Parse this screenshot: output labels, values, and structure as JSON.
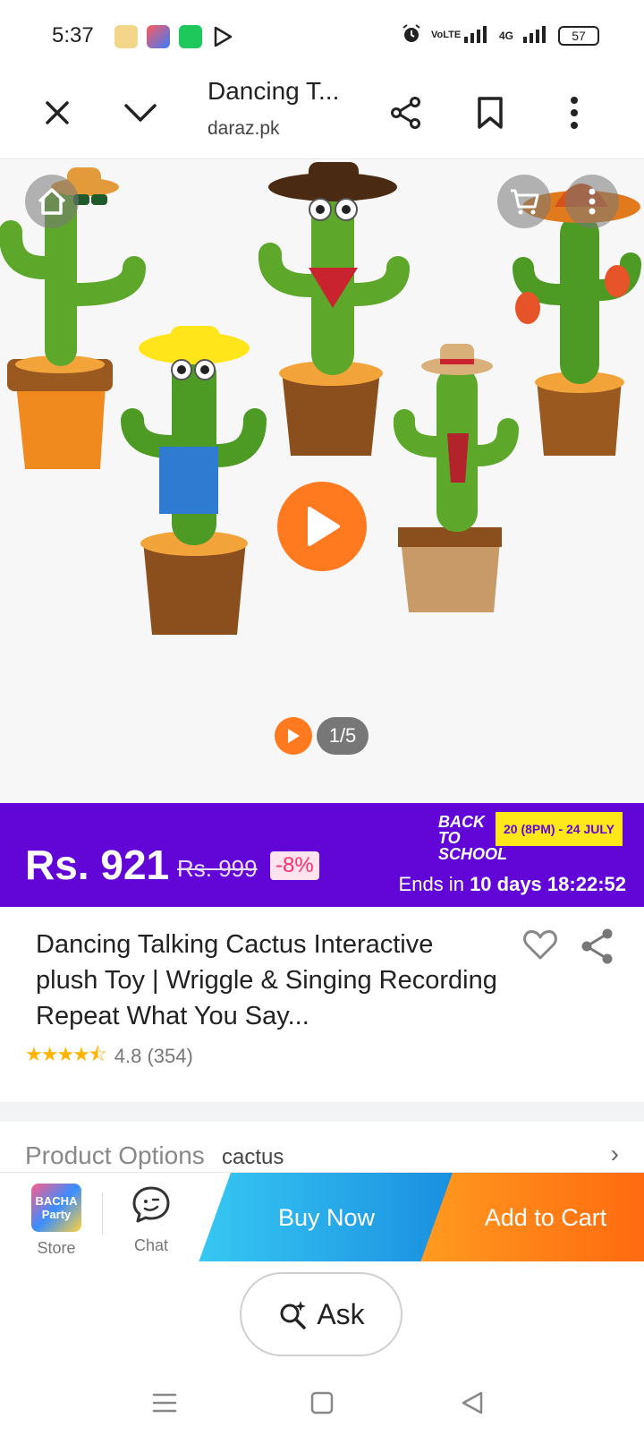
{
  "status_bar": {
    "time": "5:37",
    "volte": "VoLTE",
    "network": "4G",
    "battery": "57"
  },
  "browser": {
    "title": "Dancing T...",
    "domain": "daraz.pk"
  },
  "gallery": {
    "counter": "1/5"
  },
  "price": {
    "current": "Rs. 921",
    "original": "Rs. 999",
    "discount": "-8%",
    "promo_label": "BACK TO SCHOOL",
    "promo_dates": "20 (8PM) - 24 JULY",
    "ends_prefix": "Ends in",
    "ends_days": "10 days",
    "ends_time": "18:22:52"
  },
  "product": {
    "title": "Dancing Talking Cactus Interactive plush Toy | Wriggle & Singing Recording Repeat What You Say...",
    "rating": "4.8",
    "reviews": "(354)",
    "stars_value": 4.8
  },
  "options": {
    "label": "Product Options",
    "value": "cactus"
  },
  "actions": {
    "store_label": "Store",
    "store_logo_text": "BACHA Party",
    "chat_label": "Chat",
    "buy_now": "Buy Now",
    "add_to_cart": "Add to Cart"
  },
  "ask": {
    "label": "Ask"
  },
  "colors": {
    "brand_purple": "#6206d8",
    "accent_orange": "#ff7a1f",
    "buy_blue": "#1a8fe0",
    "promo_yellow": "#ffe81a"
  }
}
